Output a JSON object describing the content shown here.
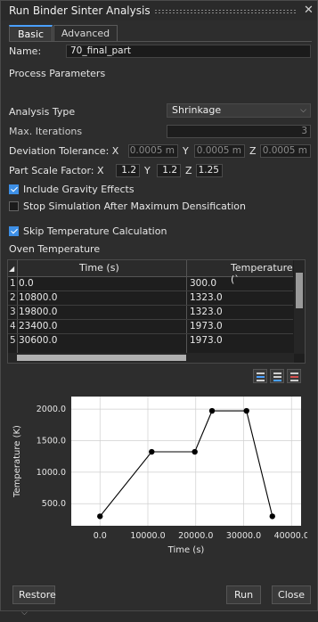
{
  "window": {
    "title": "Run Binder Sinter Analysis",
    "close_glyph": "✕"
  },
  "tabs": [
    {
      "label": "Basic",
      "active": true
    },
    {
      "label": "Advanced",
      "active": false
    }
  ],
  "name": {
    "label": "Name:",
    "value": "70_final_part"
  },
  "process": {
    "heading": "Process Parameters",
    "analysis_type": {
      "label": "Analysis Type",
      "value": "Shrinkage"
    },
    "max_iterations": {
      "label": "Max. Iterations",
      "value": "3"
    },
    "deviation": {
      "label": "Deviation Tolerance: X",
      "x": "0.0005 m",
      "y_label": "Y",
      "y": "0.0005 m",
      "z_label": "Z",
      "z": "0.0005 m"
    },
    "scale": {
      "label": "Part Scale Factor:  X",
      "x": "1.2",
      "y_label": "Y",
      "y": "1.2",
      "z_label": "Z",
      "z": "1.25"
    }
  },
  "checks": {
    "gravity": {
      "label": "Include Gravity Effects",
      "checked": true
    },
    "stop_sim": {
      "label": "Stop Simulation After Maximum Densification",
      "checked": false
    },
    "skip_temp": {
      "label": "Skip Temperature Calculation",
      "checked": true
    }
  },
  "oven": {
    "heading": "Oven Temperature",
    "columns": [
      "Time (s)",
      "Temperature (`"
    ],
    "rows": [
      {
        "n": "1",
        "time": "0.0",
        "temp": "300.0"
      },
      {
        "n": "2",
        "time": "10800.0",
        "temp": "1323.0"
      },
      {
        "n": "3",
        "time": "19800.0",
        "temp": "1323.0"
      },
      {
        "n": "4",
        "time": "23400.0",
        "temp": "1973.0"
      },
      {
        "n": "5",
        "time": "30600.0",
        "temp": "1973.0"
      }
    ]
  },
  "chart_data": {
    "type": "line",
    "x": [
      0,
      10800,
      19800,
      23400,
      30600,
      36000
    ],
    "y": [
      300,
      1323,
      1323,
      1973,
      1973,
      300
    ],
    "xlabel": "Time (s)",
    "ylabel": "Temperature (K)",
    "xlim": [
      -6000,
      42000
    ],
    "ylim": [
      150,
      2200
    ],
    "xticks": [
      0,
      10000,
      20000,
      30000,
      40000
    ],
    "xtick_labels": [
      "0.0",
      "10000.0",
      "20000.0",
      "30000.0",
      "40000.0"
    ],
    "yticks": [
      500,
      1000,
      1500,
      2000
    ],
    "ytick_labels": [
      "500.0",
      "1000.0",
      "1500.0",
      "2000.0"
    ],
    "grid": true,
    "colors": {
      "background": "#ffffff",
      "line": "#000000",
      "axes_bg": "#2d2d2d",
      "grid": "#cfcfcf"
    }
  },
  "footer": {
    "restore": "Restore",
    "run": "Run",
    "close": "Close"
  },
  "colors": {
    "accent": "#3d8fe6"
  }
}
